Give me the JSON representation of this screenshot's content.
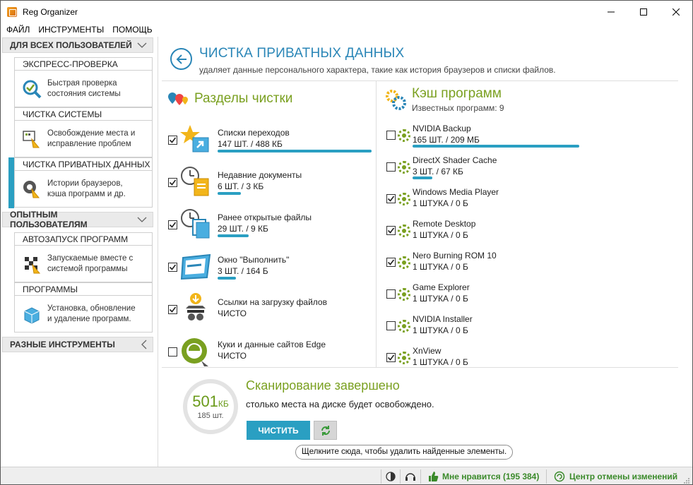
{
  "window": {
    "title": "Reg Organizer"
  },
  "menu": [
    "ФАЙЛ",
    "ИНСТРУМЕНТЫ",
    "ПОМОЩЬ"
  ],
  "sidebar": {
    "group1": "ДЛЯ ВСЕХ ПОЛЬЗОВАТЕЛЕЙ",
    "group2": "ОПЫТНЫМ ПОЛЬЗОВАТЕЛЯМ",
    "group3": "РАЗНЫЕ ИНСТРУМЕНТЫ",
    "cards": [
      {
        "title": "ЭКСПРЕСС-ПРОВЕРКА",
        "desc1": "Быстрая проверка",
        "desc2": "состояния системы"
      },
      {
        "title": "ЧИСТКА СИСТЕМЫ",
        "desc1": "Освобождение места и",
        "desc2": "исправление проблем"
      },
      {
        "title": "ЧИСТКА ПРИВАТНЫХ ДАННЫХ",
        "desc1": "Истории браузеров,",
        "desc2": "кэша программ и др."
      },
      {
        "title": "АВТОЗАПУСК ПРОГРАММ",
        "desc1": "Запускаемые вместе с",
        "desc2": "системой программы"
      },
      {
        "title": "ПРОГРАММЫ",
        "desc1": "Установка, обновление",
        "desc2": "и удаление программ."
      }
    ]
  },
  "page": {
    "title": "ЧИСТКА ПРИВАТНЫХ ДАННЫХ",
    "subtitle": "удаляет данные персонального характера, такие как история браузеров и списки файлов."
  },
  "sections": {
    "title": "Разделы чистки",
    "items": [
      {
        "name": "Списки переходов",
        "value": "147 ШТ. / 488 КБ",
        "checked": true,
        "fill": 1.0
      },
      {
        "name": "Недавние документы",
        "value": "6 ШТ. / 3 КБ",
        "checked": true,
        "fill": 0.15
      },
      {
        "name": "Ранее открытые файлы",
        "value": "29 ШТ. / 9 КБ",
        "checked": true,
        "fill": 0.2
      },
      {
        "name": "Окно \"Выполнить\"",
        "value": "3 ШТ. / 164 Б",
        "checked": true,
        "fill": 0.12
      },
      {
        "name": "Ссылки на загрузку файлов",
        "value": "ЧИСТО",
        "checked": true,
        "fill": 0
      },
      {
        "name": "Куки и данные сайтов Edge",
        "value": "ЧИСТО",
        "checked": false,
        "fill": 0
      }
    ]
  },
  "cache": {
    "title": "Кэш программ",
    "subtitle": "Известных программ: 9",
    "items": [
      {
        "name": "NVIDIA Backup",
        "value": "165 ШТ. / 209 МБ",
        "checked": false,
        "fill": 1.0
      },
      {
        "name": "DirectX Shader Cache",
        "value": "3 ШТ. / 67 КБ",
        "checked": false,
        "fill": 0.12
      },
      {
        "name": "Windows Media Player",
        "value": "1 ШТУКА / 0 Б",
        "checked": true,
        "fill": 0
      },
      {
        "name": "Remote Desktop",
        "value": "1 ШТУКА / 0 Б",
        "checked": true,
        "fill": 0
      },
      {
        "name": "Nero Burning ROM 10",
        "value": "1 ШТУКА / 0 Б",
        "checked": true,
        "fill": 0
      },
      {
        "name": "Game Explorer",
        "value": "1 ШТУКА / 0 Б",
        "checked": false,
        "fill": 0
      },
      {
        "name": "NVIDIA Installer",
        "value": "1 ШТУКА / 0 Б",
        "checked": false,
        "fill": 0
      },
      {
        "name": "XnView",
        "value": "1 ШТУКА / 0 Б",
        "checked": true,
        "fill": 0
      }
    ]
  },
  "result": {
    "size": "501",
    "unit": "КБ",
    "count": "185 шт.",
    "title": "Сканирование завершено",
    "subtitle": "столько места на диске будет освобождено.",
    "clean_label": "ЧИСТИТЬ",
    "tooltip": "Щелкните сюда, чтобы удалить найденные элементы."
  },
  "status": {
    "like": "Мне нравится (195 384)",
    "undo": "Центр отмены изменений"
  },
  "colors": {
    "accent": "#2a9fc2",
    "green": "#7aa020",
    "title_blue": "#2a86b7"
  }
}
